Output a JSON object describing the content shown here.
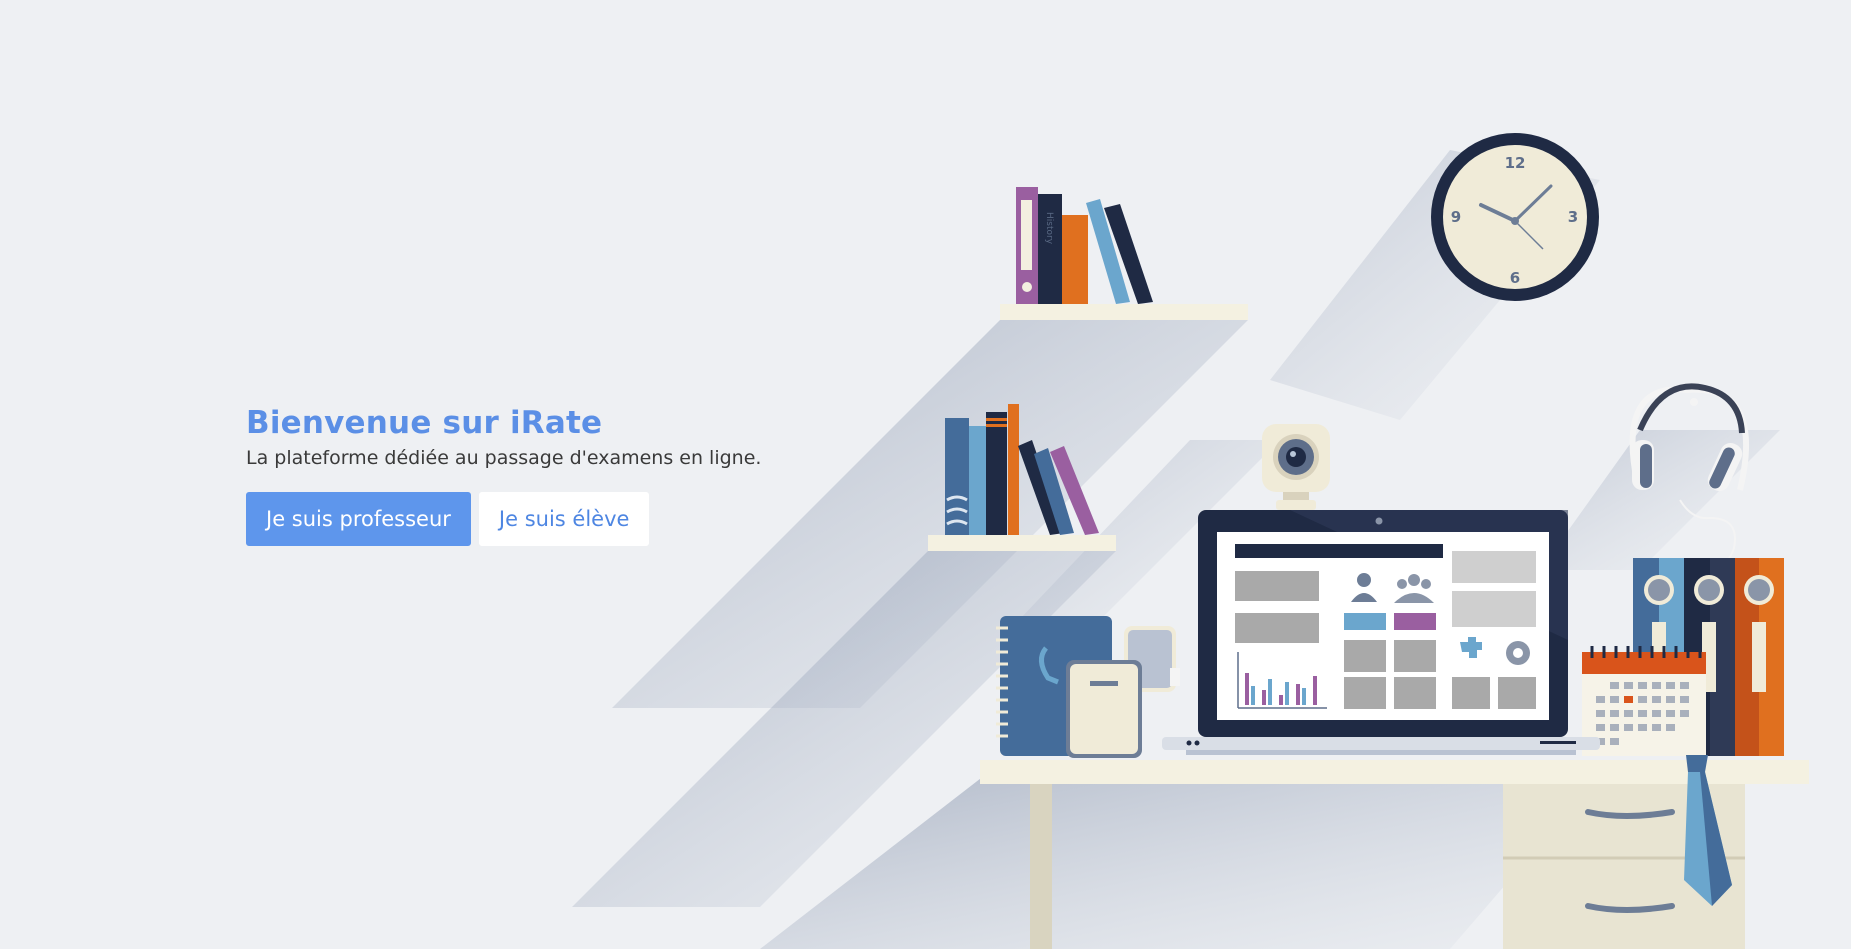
{
  "hero": {
    "title": "Bienvenue sur iRate",
    "subtitle": "La plateforme dédiée au passage d'examens en ligne.",
    "teacher_button": "Je suis professeur",
    "student_button": "Je suis élève"
  },
  "illustration": {
    "clock_numbers": [
      "12",
      "3",
      "6",
      "9"
    ],
    "book_spine_text": "History"
  },
  "colors": {
    "background": "#eef0f3",
    "accent": "#5b8fe6",
    "navy": "#1f2a44",
    "steel_blue": "#446c9a",
    "light_blue": "#6ba6cd",
    "orange": "#e0701f",
    "purple": "#9a5fa0",
    "cream": "#f3efe0"
  }
}
